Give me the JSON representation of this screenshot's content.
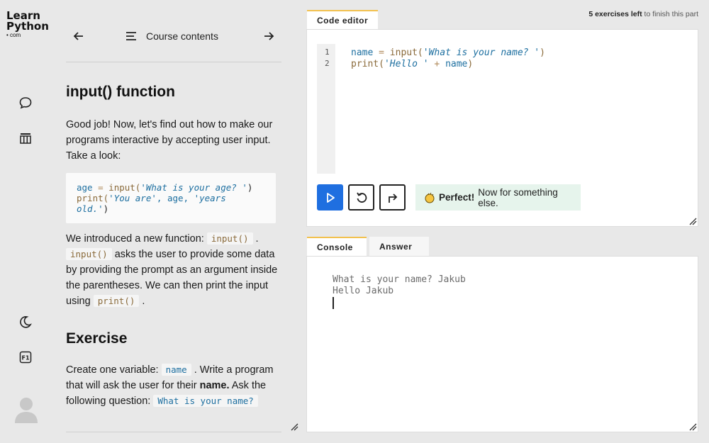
{
  "logo": {
    "line1": "Learn",
    "line2": "Python",
    "line3": "• com"
  },
  "rail": {
    "icons": [
      "chat-icon",
      "library-icon",
      "moon-icon",
      "f1-key-icon",
      "avatar"
    ]
  },
  "nav": {
    "prev": "previous-arrow",
    "contents_label": "Course contents",
    "next": "next-arrow"
  },
  "lesson": {
    "title": "input() function",
    "intro": "Good job! Now, let's find out how to make our programs interactive by accepting user input. Take a look:",
    "example_code": {
      "l1_var": "age",
      "l1_op": "=",
      "l1_fn": "input(",
      "l1_str": "'What is your age? '",
      "l1_close": ")",
      "l2_fn": "print(",
      "l2_str1": "'You are'",
      "l2_sep": ", age, ",
      "l2_str2": "'years",
      "l3_str": "old.'",
      "l3_close": ")"
    },
    "para2_a": "We introduced a new function:",
    "para2_code1": "input()",
    "para2_b": ".",
    "para2_code2": "input()",
    "para2_c": "asks the user to provide some data by providing the prompt as an argument inside the parentheses. We can then print the input using",
    "para2_code3": "print()",
    "para2_d": ".",
    "exercise_title": "Exercise",
    "ex_a": "Create one variable:",
    "ex_code1": "name",
    "ex_b": ". Write a program that will ask the user for their",
    "ex_bold": "name.",
    "ex_c": "Ask the following question:",
    "ex_code2": "What is your name?"
  },
  "editor": {
    "tab": "Code editor",
    "exercises_left_bold": "5 exercises left",
    "exercises_left_rest": "to finish this part",
    "line_numbers": [
      "1",
      "2"
    ],
    "line1": {
      "var": "name",
      "op": " = ",
      "fn": "input(",
      "str": "'What is your name? '",
      "close": ")"
    },
    "line2": {
      "fn": "print(",
      "str": "'Hello '",
      "op": " + ",
      "var": "name",
      "close": ")"
    },
    "run_button": "run",
    "reset_button": "reset",
    "skip_button": "skip",
    "feedback_bold": "Perfect!",
    "feedback_rest": "Now for something else."
  },
  "console": {
    "tab_console": "Console",
    "tab_answer": "Answer",
    "lines": [
      "What is your name? Jakub",
      "Hello Jakub"
    ]
  },
  "colors": {
    "run_button": "#1f6fe0",
    "tab_accent": "#f2c14e",
    "feedback_bg": "#e6f4ec"
  }
}
